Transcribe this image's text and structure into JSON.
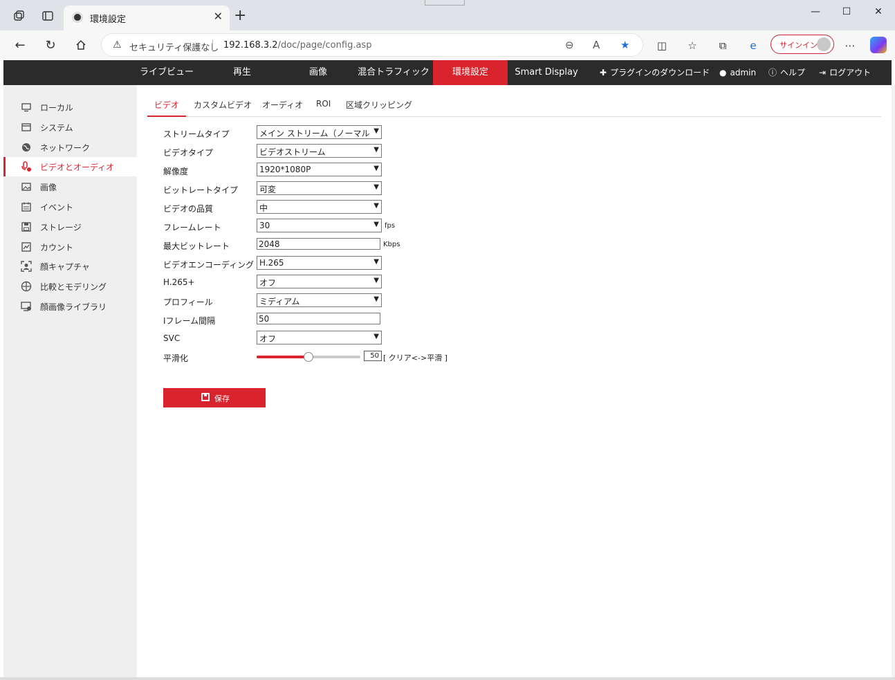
{
  "browser": {
    "tab_title": "環境設定",
    "security_text": "セキュリティ保護なし",
    "url_host": "192.168.3.2",
    "url_path": "/doc/page/config.asp",
    "signin_label": "サインイン"
  },
  "topnav": {
    "items": [
      "ライブビュー",
      "再生",
      "画像",
      "混合トラフィック",
      "環境設定",
      "Smart Display"
    ],
    "active": "環境設定",
    "plugin_download": "プラグインのダウンロード",
    "user": "admin",
    "help": "ヘルプ",
    "logout": "ログアウト"
  },
  "sidebar": {
    "items": [
      {
        "label": "ローカル",
        "icon": "monitor-icon"
      },
      {
        "label": "システム",
        "icon": "system-icon"
      },
      {
        "label": "ネットワーク",
        "icon": "globe-icon"
      },
      {
        "label": "ビデオとオーディオ",
        "icon": "video-audio-icon"
      },
      {
        "label": "画像",
        "icon": "image-icon"
      },
      {
        "label": "イベント",
        "icon": "calendar-icon"
      },
      {
        "label": "ストレージ",
        "icon": "save-icon"
      },
      {
        "label": "カウント",
        "icon": "chart-icon"
      },
      {
        "label": "顔キャプチャ",
        "icon": "face-capture-icon"
      },
      {
        "label": "比較とモデリング",
        "icon": "compare-icon"
      },
      {
        "label": "顔画像ライブラリ",
        "icon": "face-library-icon"
      }
    ],
    "active_index": 3
  },
  "subtabs": {
    "items": [
      "ビデオ",
      "カスタムビデオ",
      "オーディオ",
      "ROI",
      "区域クリッピング"
    ],
    "active": "ビデオ"
  },
  "form": {
    "stream_type": {
      "label": "ストリームタイプ",
      "value": "メイン ストリーム（ノーマル）"
    },
    "video_type": {
      "label": "ビデオタイプ",
      "value": "ビデオストリーム"
    },
    "resolution": {
      "label": "解像度",
      "value": "1920*1080P"
    },
    "bitrate_type": {
      "label": "ビットレートタイプ",
      "value": "可変"
    },
    "video_quality": {
      "label": "ビデオの品質",
      "value": "中"
    },
    "frame_rate": {
      "label": "フレームレート",
      "value": "30",
      "unit": "fps"
    },
    "max_bitrate": {
      "label": "最大ビットレート",
      "value": "2048",
      "unit": "Kbps"
    },
    "video_encoding": {
      "label": "ビデオエンコーディング",
      "value": "H.265"
    },
    "h265_plus": {
      "label": "H.265+",
      "value": "オフ"
    },
    "profile": {
      "label": "プロフィール",
      "value": "ミディアム"
    },
    "i_frame_interval": {
      "label": "Iフレーム間隔",
      "value": "50"
    },
    "svc": {
      "label": "SVC",
      "value": "オフ"
    },
    "smoothing": {
      "label": "平滑化",
      "value": "50",
      "level": 0.5,
      "desc": "[ クリア<->平滑 ]"
    }
  },
  "save_label": "保存",
  "colors": {
    "accent": "#d9232d",
    "nav_bg": "#2b2b2b",
    "sidebar_bg": "#efefef"
  }
}
